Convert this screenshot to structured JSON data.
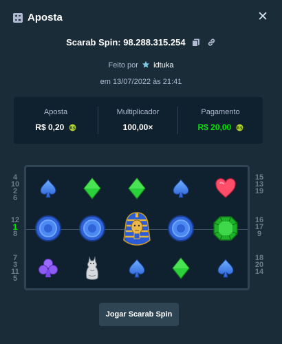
{
  "header": {
    "title": "Aposta",
    "title_icon": "receipt-icon",
    "close_icon": "close-icon",
    "close_glyph": "✕"
  },
  "spin": {
    "label": "Scarab Spin: 98.288.315.254",
    "copy_icon": "copy-icon",
    "link_icon": "link-icon"
  },
  "byline": {
    "prefix": "Feito por",
    "user_icon": "star-icon",
    "user": "idtuka"
  },
  "date": "em 13/07/2022 às 21:41",
  "stats": {
    "bet": {
      "label": "Aposta",
      "value": "R$ 0,20"
    },
    "multiplier": {
      "label": "Multiplicador",
      "value": "100,00×"
    },
    "payout": {
      "label": "Pagamento",
      "value": "R$ 20,00"
    }
  },
  "paylines": {
    "left": {
      "top": [
        "4",
        "10",
        "2",
        "6"
      ],
      "mid": [
        "12",
        "1",
        "8"
      ],
      "bottom": [
        "7",
        "3",
        "11",
        "5"
      ]
    },
    "right": {
      "top": [
        "15",
        "13",
        "19"
      ],
      "mid": [
        "16",
        "17",
        "9"
      ],
      "bottom": [
        "18",
        "20",
        "14"
      ]
    },
    "active": "1"
  },
  "grid": [
    [
      "spade",
      "diamond",
      "diamond",
      "spade",
      "heart"
    ],
    [
      "coin",
      "coin",
      "pharaoh",
      "coin",
      "emerald"
    ],
    [
      "club",
      "cat",
      "spade",
      "diamond",
      "spade"
    ]
  ],
  "colors": {
    "background": "#1a2c38",
    "panel": "#0f212e",
    "border": "#2f4553",
    "accent_green": "#00e701",
    "muted_text": "#b1bad3"
  },
  "button": {
    "label": "Jogar Scarab Spin"
  }
}
